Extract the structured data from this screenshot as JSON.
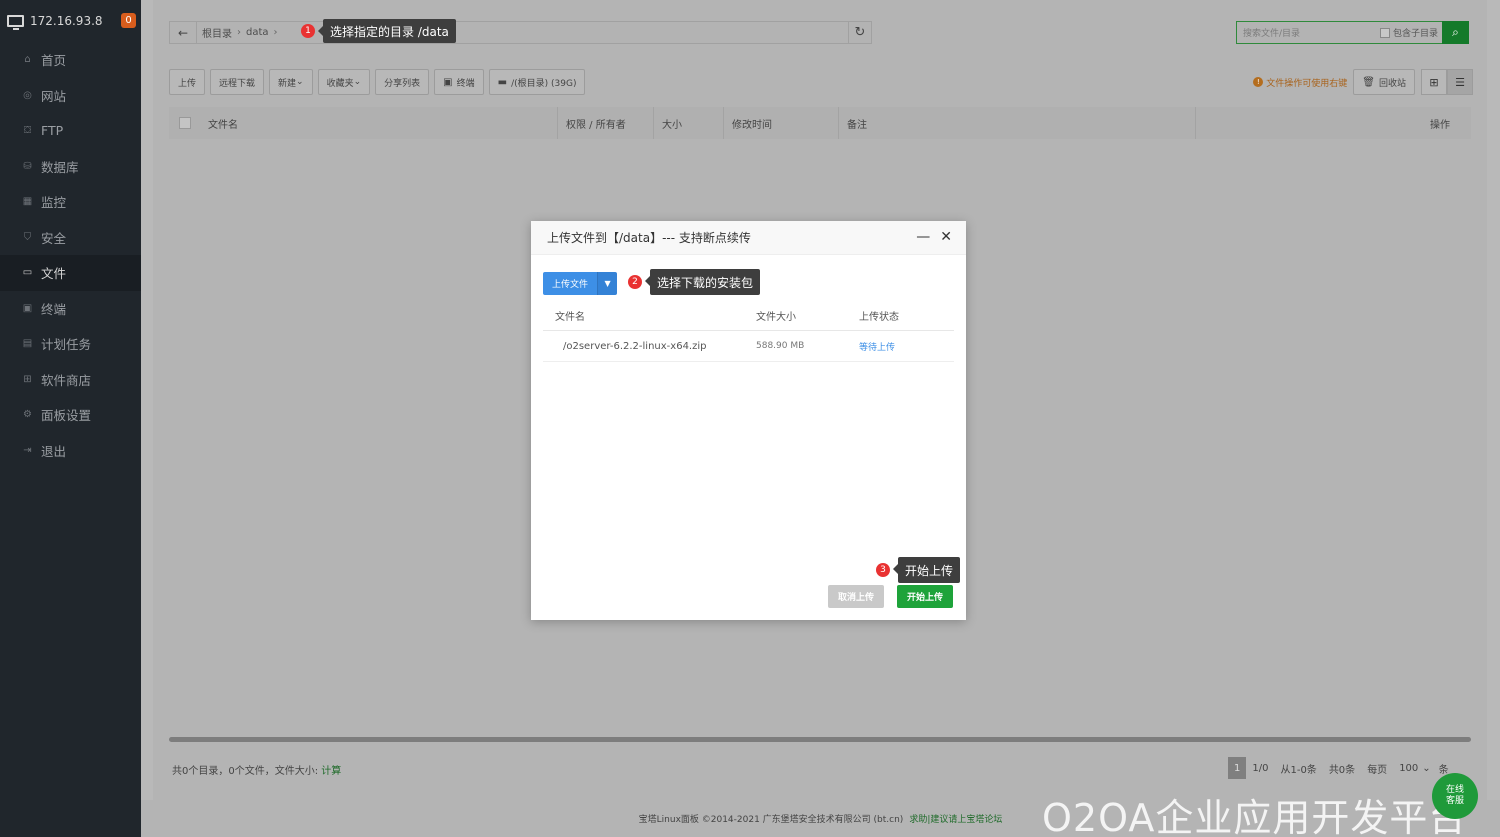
{
  "sidebar": {
    "host": "172.16.93.8",
    "badge": "0",
    "items": [
      {
        "label": "首页",
        "icon": "home-icon",
        "glyph": "⌂"
      },
      {
        "label": "网站",
        "icon": "globe-icon",
        "glyph": "◎"
      },
      {
        "label": "FTP",
        "icon": "ftp-icon",
        "glyph": "⛋"
      },
      {
        "label": "数据库",
        "icon": "database-icon",
        "glyph": "⛁"
      },
      {
        "label": "监控",
        "icon": "monitor-icon",
        "glyph": "▦"
      },
      {
        "label": "安全",
        "icon": "shield-icon",
        "glyph": "⛉"
      },
      {
        "label": "文件",
        "icon": "folder-icon",
        "glyph": "▭"
      },
      {
        "label": "终端",
        "icon": "terminal-icon",
        "glyph": "▣"
      },
      {
        "label": "计划任务",
        "icon": "calendar-icon",
        "glyph": "▤"
      },
      {
        "label": "软件商店",
        "icon": "apps-icon",
        "glyph": "⊞"
      },
      {
        "label": "面板设置",
        "icon": "gear-icon",
        "glyph": "⚙"
      },
      {
        "label": "退出",
        "icon": "logout-icon",
        "glyph": "⇥"
      }
    ]
  },
  "breadcrumb": {
    "root": "根目录",
    "current": "data"
  },
  "tips": {
    "t1": "选择指定的目录   /data",
    "t2": "选择下载的安装包",
    "t3": "开始上传",
    "n1": "1",
    "n2": "2",
    "n3": "3"
  },
  "search": {
    "placeholder": "搜索文件/目录",
    "sub_label": "包含子目录"
  },
  "toolbar": {
    "upload": "上传",
    "remote_download": "远程下载",
    "new": "新建",
    "favorites": "收藏夹",
    "share_list": "分享列表",
    "terminal": "终端",
    "disk": "/(根目录) (39G)"
  },
  "right_tools": {
    "hint": "文件操作可使用右键",
    "recycle": "回收站"
  },
  "table": {
    "col_name": "文件名",
    "col_perm": "权限 / 所有者",
    "col_size": "大小",
    "col_mtime": "修改时间",
    "col_note": "备注",
    "col_ops": "操作"
  },
  "footer": {
    "summary": "共0个目录，0个文件，文件大小:",
    "calc": "计算",
    "page_cur": "1",
    "page_info": "1/0",
    "range": "从1-0条",
    "total": "共0条",
    "per_page_label": "每页",
    "per_page": "100",
    "unit": "条"
  },
  "bottom": {
    "copyright": "宝塔Linux面板 ©2014-2021 广东堡塔安全技术有限公司 (bt.cn)",
    "link": "求助|建议请上宝塔论坛"
  },
  "watermark": "O2OA企业应用开发平台",
  "online": "在线\n客服",
  "modal": {
    "title": "上传文件到【/data】--- 支持断点续传",
    "upload_btn": "上传文件",
    "col_name": "文件名",
    "col_size": "文件大小",
    "col_status": "上传状态",
    "file": {
      "name": "/o2server-6.2.2-linux-x64.zip",
      "size": "588.90 MB",
      "status": "等待上传"
    },
    "cancel": "取消上传",
    "start": "开始上传"
  }
}
